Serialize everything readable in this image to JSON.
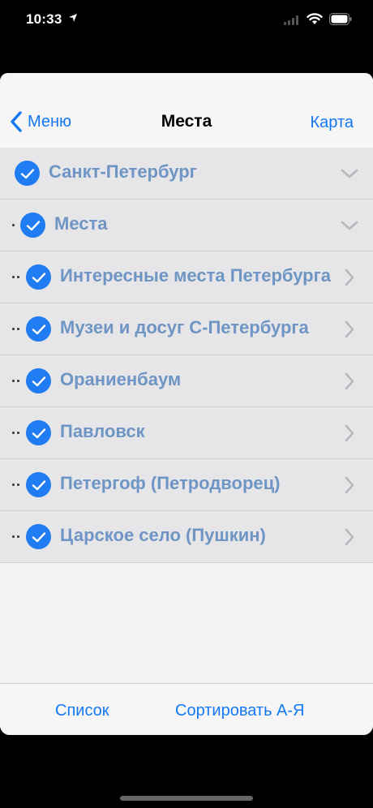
{
  "status_bar": {
    "time": "10:33"
  },
  "navbar": {
    "back_label": "Меню",
    "title": "Места",
    "right_label": "Карта"
  },
  "rows": [
    {
      "label": "Санкт-Петербург",
      "level": 0,
      "expanded": true
    },
    {
      "label": "Места",
      "level": 1,
      "expanded": true
    },
    {
      "label": "Интересные места Петербурга",
      "level": 2,
      "expanded": false
    },
    {
      "label": "Музеи и досуг С-Петербурга",
      "level": 2,
      "expanded": false
    },
    {
      "label": "Ораниенбаум",
      "level": 2,
      "expanded": false
    },
    {
      "label": "Павловск",
      "level": 2,
      "expanded": false
    },
    {
      "label": "Петергоф (Петродворец)",
      "level": 2,
      "expanded": false
    },
    {
      "label": "Царское село (Пушкин)",
      "level": 2,
      "expanded": false
    }
  ],
  "toolbar": {
    "list_label": "Список",
    "sort_label": "Сортировать А-Я"
  },
  "colors": {
    "accent": "#1478f5",
    "check": "#1f7cf3",
    "row_text": "#6e95c4"
  }
}
